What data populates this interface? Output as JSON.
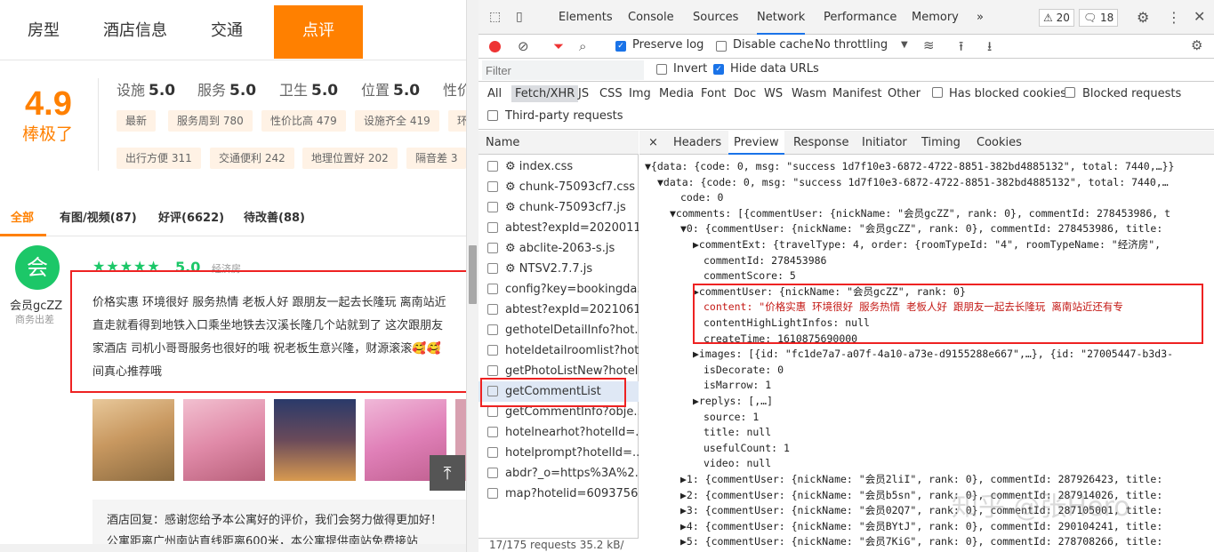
{
  "hotel_page": {
    "tabs": [
      "房型",
      "酒店信息",
      "交通",
      "点评"
    ],
    "overall_score": "4.9",
    "overall_word": "棒极了",
    "sub_scores": [
      {
        "label": "设施",
        "value": "5.0"
      },
      {
        "label": "服务",
        "value": "5.0"
      },
      {
        "label": "卫生",
        "value": "5.0"
      },
      {
        "label": "位置",
        "value": "5.0"
      },
      {
        "label": "性价",
        "value": ""
      }
    ],
    "chips_row1": [
      "最新",
      "服务周到 780",
      "性价比高 479",
      "设施齐全 419",
      "环"
    ],
    "chips_row2": [
      "出行方便 311",
      "交通便利 242",
      "地理位置好 202",
      "隔音差 3"
    ],
    "filters": [
      "全部",
      "有图/视频(87)",
      "好评(6622)",
      "待改善(88)"
    ],
    "review": {
      "avatar_char": "会",
      "user_name": "会员gcZZ",
      "user_type": "商务出差",
      "stars": "★★★★★",
      "score": "5.0",
      "room": "经济房",
      "lines": [
        "价格实惠 环境很好 服务热情 老板人好 跟朋友一起去长隆玩 离南站近",
        "直走就看得到地铁入口乘坐地铁去汉溪长隆几个站就到了 这次跟朋友",
        "家酒店 司机小哥哥服务也很好的哦 祝老板生意兴隆，财源滚滚🥰🥰",
        "间真心推荐哦"
      ],
      "reply_lines": [
        "酒店回复：感谢您给予本公寓好的评价，我们会努力做得更加好！",
        "公寓距离广州南站直线距离600米，本公寓提供南站免费接站"
      ]
    },
    "back_to_top": "⤒"
  },
  "devtools": {
    "tabs": [
      "Elements",
      "Console",
      "Sources",
      "Network",
      "Performance",
      "Memory",
      "»"
    ],
    "warnings": "⚠ 20",
    "messages": "🗨 18",
    "preserve_log": "Preserve log",
    "disable_cache": "Disable cache",
    "throttling": "No throttling",
    "filter_placeholder": "Filter",
    "invert": "Invert",
    "hide_data_urls": "Hide data URLs",
    "type_filters": [
      "All",
      "Fetch/XHR",
      "JS",
      "CSS",
      "Img",
      "Media",
      "Font",
      "Doc",
      "WS",
      "Wasm",
      "Manifest",
      "Other"
    ],
    "blocked_cookies": "Has blocked cookies",
    "blocked_requests": "Blocked requests",
    "third_party": "Third-party requests",
    "name_header": "Name",
    "requests": [
      "⚙ index.css",
      "⚙ chunk-75093cf7.css",
      "⚙ chunk-75093cf7.js",
      "abtest?expId=2020011...",
      "⚙ abclite-2063-s.js",
      "⚙ NTSV2.7.7.js",
      "config?key=bookingda...",
      "abtest?expId=2021061...",
      "gethotelDetailInfo?hot...",
      "hoteldetailroomlist?hot...",
      "getPhotoListNew?hotel...",
      "getCommentList",
      "getCommentInfo?obje...",
      "hotelnearhot?hotelId=...",
      "hotelprompt?hotelId=...",
      "abdr?_o=https%3A%2...",
      "map?hotelid=6093756..."
    ],
    "footer": "17/175 requests   35.2 kB/",
    "panel_tabs": [
      "×",
      "Headers",
      "Preview",
      "Response",
      "Initiator",
      "Timing",
      "Cookies"
    ],
    "preview_lines": [
      "▼{data: {code: 0, msg: \"success 1d7f10e3-6872-4722-8851-382bd4885132\", total: 7440,…}}",
      "▼data: {code: 0, msg: \"success 1d7f10e3-6872-4722-8851-382bd4885132\", total: 7440,…",
      "code: 0",
      "▼comments: [{commentUser: {nickName: \"会员gcZZ\", rank: 0}, commentId: 278453986, t",
      "▼0: {commentUser: {nickName: \"会员gcZZ\", rank: 0}, commentId: 278453986, title:",
      "▶commentExt: {travelType: 4, order: {roomTypeId: \"4\", roomTypeName: \"经济房\",",
      "commentId: 278453986",
      "commentScore: 5",
      "▶commentUser: {nickName: \"会员gcZZ\", rank: 0}",
      "content: \"价格实惠 环境很好 服务热情 老板人好 跟朋友一起去长隆玩 离南站近还有专",
      "contentHighLightInfos: null",
      "createTime: 1610875690000",
      "▶images: [{id: \"fc1de7a7-a07f-4a10-a73e-d9155288e667\",…}, {id: \"27005447-b3d3-",
      "isDecorate: 0",
      "isMarrow: 1",
      "▶replys: [,…]",
      "source: 1",
      "title: null",
      "usefulCount: 1",
      "video: null",
      "▶1: {commentUser: {nickName: \"会员2liI\", rank: 0}, commentId: 287926423, title:",
      "▶2: {commentUser: {nickName: \"会员b5sn\", rank: 0}, commentId: 287914026, title:",
      "▶3: {commentUser: {nickName: \"会员02Q7\", rank: 0}, commentId: 287105001, title:",
      "▶4: {commentUser: {nickName: \"会员BYtJ\", rank: 0}, commentId: 290104241, title:",
      "▶5: {commentUser: {nickName: \"会员7KiG\", rank: 0}, commentId: 278708266, title:"
    ],
    "watermark": "知乎 @张Hero"
  }
}
